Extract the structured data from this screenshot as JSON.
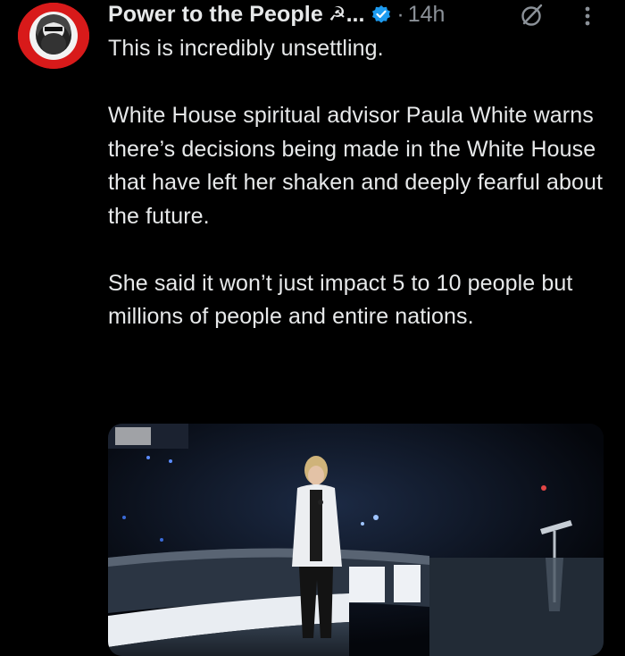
{
  "tweet": {
    "display_name": "Power to the People",
    "name_emoji": "☭",
    "name_truncation": "...",
    "verified_icon": "verified-badge-icon",
    "separator": "·",
    "timestamp": "14h",
    "grok_icon": "grok-icon",
    "more_icon": "more-options-icon",
    "avatar_icon": "profile-avatar",
    "paragraphs": [
      "This is incredibly unsettling.",
      "White House spiritual advisor Paula White warns there’s decisions being made in the White House that have left her shaken and deeply fearful about the future.",
      "She said it won’t just impact 5 to 10 people but millions of people and entire nations."
    ],
    "media_description": "video-thumbnail",
    "colors": {
      "background": "#000000",
      "text": "#e7e9ea",
      "muted": "#8b9198",
      "verified": "#1d9bf0",
      "avatar_ring": "#d81a1a"
    }
  }
}
